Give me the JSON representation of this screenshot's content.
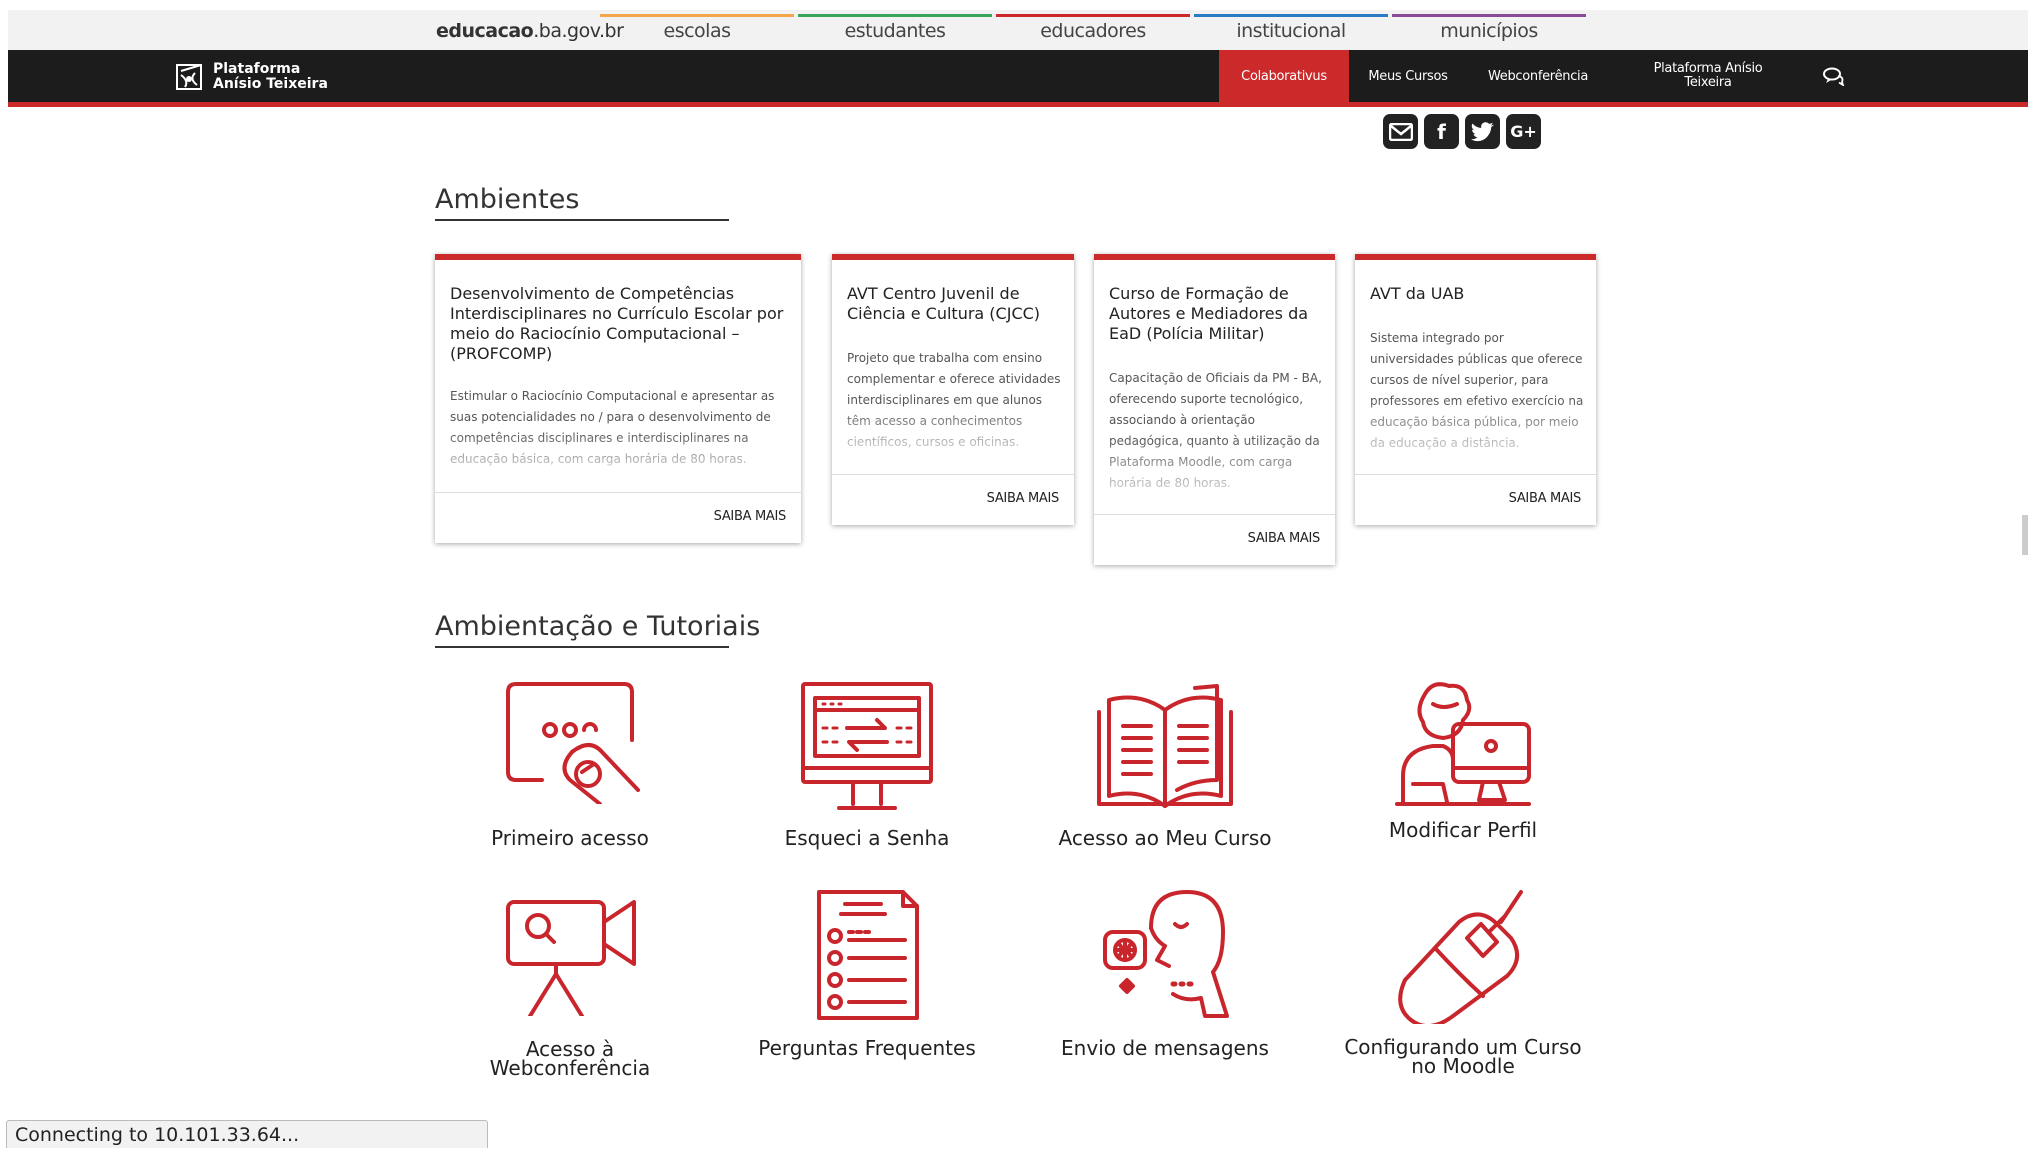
{
  "topbar": {
    "brand_bold": "educacao",
    "brand_light": ".ba.gov.br",
    "links": [
      {
        "label": "escolas",
        "color": "#f4a64a"
      },
      {
        "label": "estudantes",
        "color": "#3aa65a"
      },
      {
        "label": "educadores",
        "color": "#cc2a2a"
      },
      {
        "label": "institucional",
        "color": "#2a7ac4"
      },
      {
        "label": "municípios",
        "color": "#8a4a9a"
      }
    ]
  },
  "header": {
    "logo_line1": "Plataforma",
    "logo_line2": "Anísio Teixeira",
    "nav": [
      "Colaborativus",
      "Meus Cursos",
      "Webconferência",
      "Plataforma Anísio Teixeira"
    ],
    "chat_icon": "chat-bubbles-icon"
  },
  "social": {
    "icons": [
      "envelope-icon",
      "facebook-icon",
      "twitter-icon",
      "google-plus-icon"
    ],
    "facebook_glyph": "f",
    "google_glyph": "G+"
  },
  "ambientes": {
    "title": "Ambientes",
    "cards": [
      {
        "title": "Desenvolvimento de Competências Interdisciplinares no Currículo Escolar por meio do Raciocínio Computacional – (PROFCOMP)",
        "desc": "Estimular o Raciocínio Computacional e apresentar as suas potencialidades no / para o desenvolvimento de competências disciplinares e interdisciplinares na educação básica, com carga horária de 80 horas.",
        "more": "SAIBA MAIS"
      },
      {
        "title": "AVT Centro Juvenil de Ciência e Cultura (CJCC)",
        "desc": "Projeto que trabalha com ensino complementar e oferece atividades interdisciplinares em que alunos têm acesso a conhecimentos científicos, cursos e oficinas.",
        "more": "SAIBA MAIS"
      },
      {
        "title": "Curso de Formação de Autores e Mediadores da EaD (Polícia Militar)",
        "desc": "Capacitação de Oficiais da PM - BA, oferecendo suporte tecnológico, associando à orientação pedagógica, quanto à utilização da Plataforma Moodle, com carga horária de 80 horas.",
        "more": "SAIBA MAIS"
      },
      {
        "title": "AVT da UAB",
        "desc": "Sistema integrado por universidades públicas que oferece cursos de nível superior, para professores em efetivo exercício na educação básica pública, por meio da educação a distância.",
        "more": "SAIBA MAIS"
      }
    ]
  },
  "tutoriais": {
    "title": "Ambientação e Tutoriais",
    "accent_color": "#c8262c",
    "items": [
      {
        "label": "Primeiro acesso",
        "icon": "touch-screen-icon"
      },
      {
        "label": "Esqueci a Senha",
        "icon": "monitor-transfer-icon"
      },
      {
        "label": "Acesso ao Meu Curso",
        "icon": "open-book-icon"
      },
      {
        "label": "Modificar Perfil",
        "icon": "person-at-computer-icon"
      },
      {
        "label": "Acesso à",
        "label2": "Webconferência",
        "icon": "video-camera-icon"
      },
      {
        "label": "Perguntas Frequentes",
        "icon": "faq-document-icon"
      },
      {
        "label": "Envio de mensagens",
        "icon": "speaking-head-icon"
      },
      {
        "label": "Configurando um Curso",
        "label2": "no Moodle",
        "icon": "computer-mouse-icon"
      }
    ]
  },
  "status": {
    "text": "Connecting to 10.101.33.64..."
  }
}
